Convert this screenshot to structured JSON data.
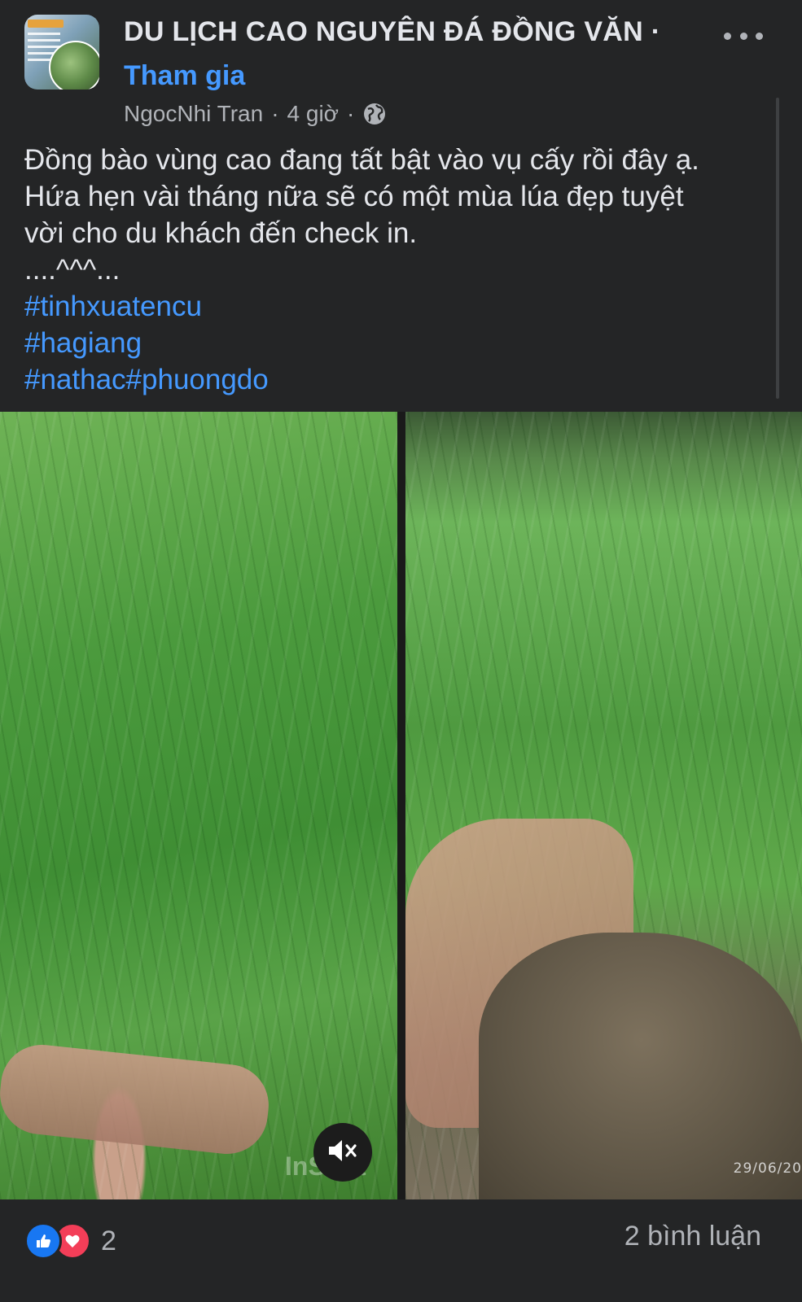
{
  "header": {
    "group_name": "DU LỊCH CAO NGUYÊN ĐÁ ĐỒNG VĂN ·",
    "join_label": "Tham gia",
    "author": "NgocNhi Tran",
    "separator": "·",
    "time": "4 giờ",
    "privacy_icon": "globe-icon",
    "more_icon": "more-options-icon"
  },
  "post": {
    "lines": [
      "Đồng bào vùng cao đang tất bật vào vụ cấy rồi đây ạ.",
      "Hứa hẹn vài tháng nữa sẽ có một mùa lúa đẹp tuyệt",
      "vời cho du khách đến check in.",
      "....^^^..."
    ],
    "hashtags": [
      "#tinhxuatencu",
      "#hagiang",
      "#nathac#phuongdo"
    ]
  },
  "media": {
    "watermark": "InShot",
    "date_stamp": "29/06/20",
    "mute_icon": "muted-speaker-icon"
  },
  "footer": {
    "reaction_icons": [
      "like-icon",
      "love-icon"
    ],
    "reaction_count": "2",
    "comments_label": "2 bình luận"
  },
  "colors": {
    "background": "#242526",
    "link": "#4599ff",
    "secondary_text": "#b0b3b8",
    "like": "#1877f2",
    "love": "#f33e58"
  }
}
